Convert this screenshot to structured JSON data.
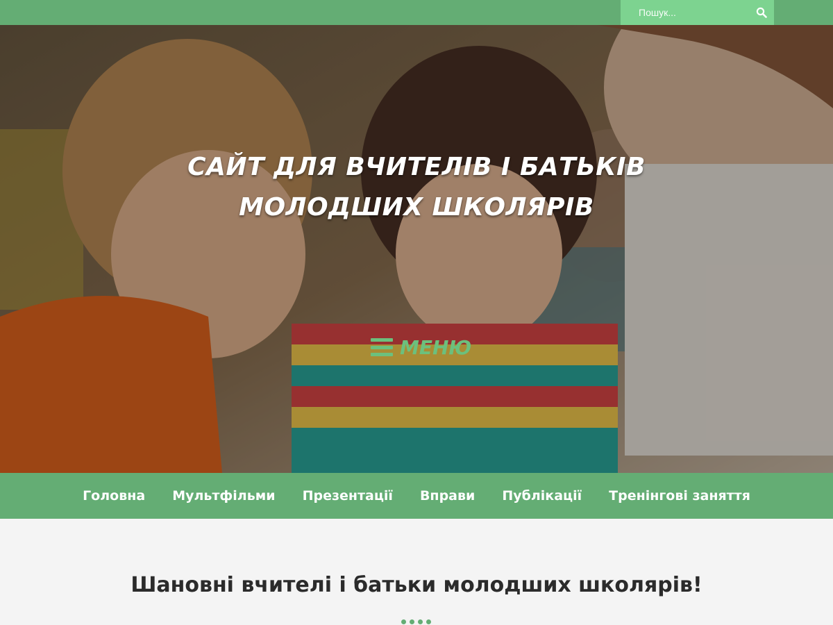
{
  "search": {
    "placeholder": "Пошук...",
    "icon": "search-icon"
  },
  "hero": {
    "title_line1": "Сайт для вчителів і батьків",
    "title_line2": "молодших школярів",
    "menu_label": "Меню",
    "menu_icon": "hamburger-icon"
  },
  "nav": {
    "items": [
      {
        "label": "Головна"
      },
      {
        "label": "Мультфільми"
      },
      {
        "label": "Презентації"
      },
      {
        "label": "Вправи"
      },
      {
        "label": "Публікації"
      },
      {
        "label": "Тренінгові заняття"
      }
    ]
  },
  "main": {
    "heading": "Шановні вчителі і батьки молодших школярів!"
  },
  "colors": {
    "accent": "#64ad74",
    "search_bg": "#7dd390",
    "menu_green": "#6cc07d",
    "page_bg": "#f4f4f4"
  }
}
